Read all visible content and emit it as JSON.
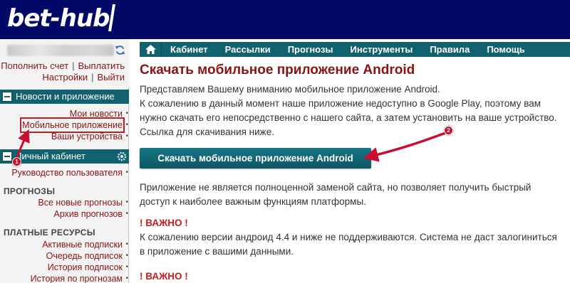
{
  "header": {
    "logo_text": "bet-hub"
  },
  "account": {
    "links_row1": [
      "Пополнить счет",
      "Выплатить"
    ],
    "links_row2": [
      "Настройки",
      "Выйти"
    ],
    "refresh_icon": "refresh-icon"
  },
  "sidebar": {
    "news_section": {
      "title": "Новости и приложение",
      "items": [
        "Мои новости",
        "Мобильное приложение",
        "Ваши устройства"
      ]
    },
    "cabinet_section": {
      "title": "Личный кабинет",
      "items": [
        "Руководство пользователя"
      ]
    },
    "forecasts": {
      "heading": "ПРОГНОЗЫ",
      "items": [
        "Все новые прогнозы",
        "Архив прогнозов"
      ]
    },
    "paid": {
      "heading": "ПЛАТНЫЕ РЕСУРСЫ",
      "items": [
        "Активные подписки",
        "Очередь подписок",
        "История подписок",
        "История по прогнозам"
      ]
    }
  },
  "topnav": {
    "items": [
      "Кабинет",
      "Рассылки",
      "Прогнозы",
      "Инструменты",
      "Правила",
      "Помощь"
    ]
  },
  "main": {
    "title": "Скачать мобильное приложение Android",
    "intro": [
      "Представляем Вашему вниманию мобильное приложение Android.",
      "К сожалению в данный момент наше приложение недоступно в Google Play, поэтому вам",
      "нужно скачать его непосредственно с нашего сайта, а затем установить на ваше устройство.",
      "Ссылка для скачивания ниже."
    ],
    "download_button": "Скачать мобильное приложение Android",
    "note": [
      "Приложение не является полноценной заменой сайта, но позволяет получить быстрый",
      "доступ к наиболее важным функциям платформы."
    ],
    "important_label": "! ВАЖНО !",
    "warning": [
      "К сожалению версии андроид 4.4 и ниже не поддерживаются. Система не даст залогиниться",
      "в приложение с вашими данными."
    ],
    "important_label_2": "! ВАЖНО !"
  },
  "annotations": {
    "marker_1": "1",
    "marker_2": "2"
  },
  "colors": {
    "header_bg": "#010866",
    "teal": "#12616f",
    "link": "#8a1313",
    "important": "#c41e1e",
    "annotation": "#c8102e"
  }
}
